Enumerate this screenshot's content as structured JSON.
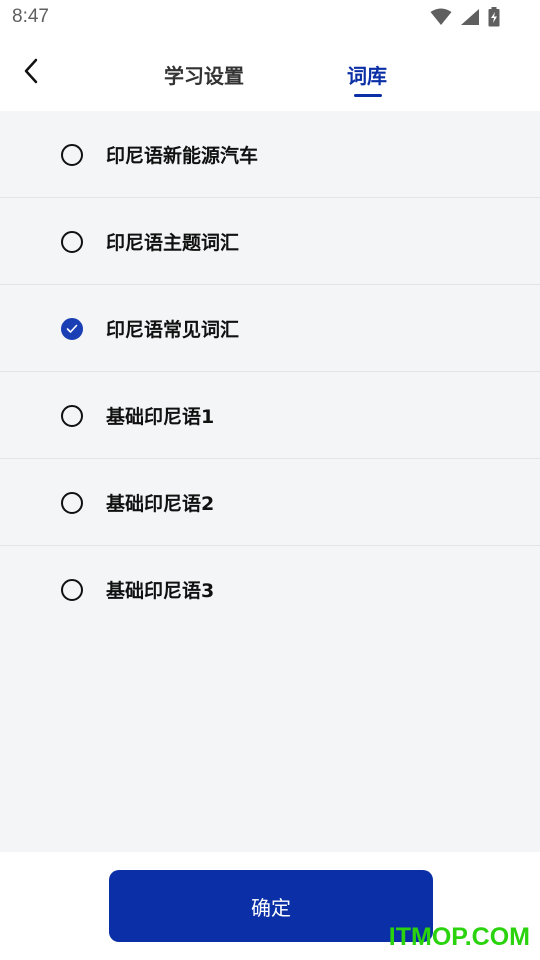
{
  "status_bar": {
    "time": "8:47",
    "icons": [
      "wifi-icon",
      "cellular-signal-icon",
      "battery-charging-icon"
    ]
  },
  "header": {
    "back_icon": "chevron-left-icon",
    "tabs": [
      {
        "label": "学习设置",
        "active": false
      },
      {
        "label": "词库",
        "active": true
      }
    ]
  },
  "word_banks": [
    {
      "label": "印尼语新能源汽车",
      "selected": false
    },
    {
      "label": "印尼语主题词汇",
      "selected": false
    },
    {
      "label": "印尼语常见词汇",
      "selected": true
    },
    {
      "label": "基础印尼语1",
      "selected": false
    },
    {
      "label": "基础印尼语2",
      "selected": false
    },
    {
      "label": "基础印尼语3",
      "selected": false
    }
  ],
  "footer": {
    "confirm_label": "确定"
  },
  "watermark": "ITMOP.COM",
  "colors": {
    "accent": "#0a2fa6",
    "list_background": "#f4f5f7",
    "watermark": "#2bd30f"
  }
}
